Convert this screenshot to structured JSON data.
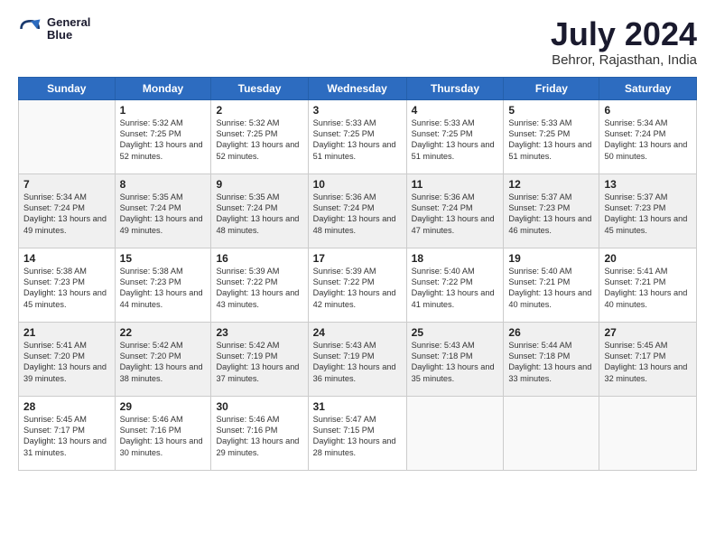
{
  "logo": {
    "line1": "General",
    "line2": "Blue"
  },
  "title": {
    "month_year": "July 2024",
    "location": "Behror, Rajasthan, India"
  },
  "weekdays": [
    "Sunday",
    "Monday",
    "Tuesday",
    "Wednesday",
    "Thursday",
    "Friday",
    "Saturday"
  ],
  "weeks": [
    [
      {
        "day": "",
        "sunrise": "",
        "sunset": "",
        "daylight": ""
      },
      {
        "day": "1",
        "sunrise": "Sunrise: 5:32 AM",
        "sunset": "Sunset: 7:25 PM",
        "daylight": "Daylight: 13 hours and 52 minutes."
      },
      {
        "day": "2",
        "sunrise": "Sunrise: 5:32 AM",
        "sunset": "Sunset: 7:25 PM",
        "daylight": "Daylight: 13 hours and 52 minutes."
      },
      {
        "day": "3",
        "sunrise": "Sunrise: 5:33 AM",
        "sunset": "Sunset: 7:25 PM",
        "daylight": "Daylight: 13 hours and 51 minutes."
      },
      {
        "day": "4",
        "sunrise": "Sunrise: 5:33 AM",
        "sunset": "Sunset: 7:25 PM",
        "daylight": "Daylight: 13 hours and 51 minutes."
      },
      {
        "day": "5",
        "sunrise": "Sunrise: 5:33 AM",
        "sunset": "Sunset: 7:25 PM",
        "daylight": "Daylight: 13 hours and 51 minutes."
      },
      {
        "day": "6",
        "sunrise": "Sunrise: 5:34 AM",
        "sunset": "Sunset: 7:24 PM",
        "daylight": "Daylight: 13 hours and 50 minutes."
      }
    ],
    [
      {
        "day": "7",
        "sunrise": "Sunrise: 5:34 AM",
        "sunset": "Sunset: 7:24 PM",
        "daylight": "Daylight: 13 hours and 49 minutes."
      },
      {
        "day": "8",
        "sunrise": "Sunrise: 5:35 AM",
        "sunset": "Sunset: 7:24 PM",
        "daylight": "Daylight: 13 hours and 49 minutes."
      },
      {
        "day": "9",
        "sunrise": "Sunrise: 5:35 AM",
        "sunset": "Sunset: 7:24 PM",
        "daylight": "Daylight: 13 hours and 48 minutes."
      },
      {
        "day": "10",
        "sunrise": "Sunrise: 5:36 AM",
        "sunset": "Sunset: 7:24 PM",
        "daylight": "Daylight: 13 hours and 48 minutes."
      },
      {
        "day": "11",
        "sunrise": "Sunrise: 5:36 AM",
        "sunset": "Sunset: 7:24 PM",
        "daylight": "Daylight: 13 hours and 47 minutes."
      },
      {
        "day": "12",
        "sunrise": "Sunrise: 5:37 AM",
        "sunset": "Sunset: 7:23 PM",
        "daylight": "Daylight: 13 hours and 46 minutes."
      },
      {
        "day": "13",
        "sunrise": "Sunrise: 5:37 AM",
        "sunset": "Sunset: 7:23 PM",
        "daylight": "Daylight: 13 hours and 45 minutes."
      }
    ],
    [
      {
        "day": "14",
        "sunrise": "Sunrise: 5:38 AM",
        "sunset": "Sunset: 7:23 PM",
        "daylight": "Daylight: 13 hours and 45 minutes."
      },
      {
        "day": "15",
        "sunrise": "Sunrise: 5:38 AM",
        "sunset": "Sunset: 7:23 PM",
        "daylight": "Daylight: 13 hours and 44 minutes."
      },
      {
        "day": "16",
        "sunrise": "Sunrise: 5:39 AM",
        "sunset": "Sunset: 7:22 PM",
        "daylight": "Daylight: 13 hours and 43 minutes."
      },
      {
        "day": "17",
        "sunrise": "Sunrise: 5:39 AM",
        "sunset": "Sunset: 7:22 PM",
        "daylight": "Daylight: 13 hours and 42 minutes."
      },
      {
        "day": "18",
        "sunrise": "Sunrise: 5:40 AM",
        "sunset": "Sunset: 7:22 PM",
        "daylight": "Daylight: 13 hours and 41 minutes."
      },
      {
        "day": "19",
        "sunrise": "Sunrise: 5:40 AM",
        "sunset": "Sunset: 7:21 PM",
        "daylight": "Daylight: 13 hours and 40 minutes."
      },
      {
        "day": "20",
        "sunrise": "Sunrise: 5:41 AM",
        "sunset": "Sunset: 7:21 PM",
        "daylight": "Daylight: 13 hours and 40 minutes."
      }
    ],
    [
      {
        "day": "21",
        "sunrise": "Sunrise: 5:41 AM",
        "sunset": "Sunset: 7:20 PM",
        "daylight": "Daylight: 13 hours and 39 minutes."
      },
      {
        "day": "22",
        "sunrise": "Sunrise: 5:42 AM",
        "sunset": "Sunset: 7:20 PM",
        "daylight": "Daylight: 13 hours and 38 minutes."
      },
      {
        "day": "23",
        "sunrise": "Sunrise: 5:42 AM",
        "sunset": "Sunset: 7:19 PM",
        "daylight": "Daylight: 13 hours and 37 minutes."
      },
      {
        "day": "24",
        "sunrise": "Sunrise: 5:43 AM",
        "sunset": "Sunset: 7:19 PM",
        "daylight": "Daylight: 13 hours and 36 minutes."
      },
      {
        "day": "25",
        "sunrise": "Sunrise: 5:43 AM",
        "sunset": "Sunset: 7:18 PM",
        "daylight": "Daylight: 13 hours and 35 minutes."
      },
      {
        "day": "26",
        "sunrise": "Sunrise: 5:44 AM",
        "sunset": "Sunset: 7:18 PM",
        "daylight": "Daylight: 13 hours and 33 minutes."
      },
      {
        "day": "27",
        "sunrise": "Sunrise: 5:45 AM",
        "sunset": "Sunset: 7:17 PM",
        "daylight": "Daylight: 13 hours and 32 minutes."
      }
    ],
    [
      {
        "day": "28",
        "sunrise": "Sunrise: 5:45 AM",
        "sunset": "Sunset: 7:17 PM",
        "daylight": "Daylight: 13 hours and 31 minutes."
      },
      {
        "day": "29",
        "sunrise": "Sunrise: 5:46 AM",
        "sunset": "Sunset: 7:16 PM",
        "daylight": "Daylight: 13 hours and 30 minutes."
      },
      {
        "day": "30",
        "sunrise": "Sunrise: 5:46 AM",
        "sunset": "Sunset: 7:16 PM",
        "daylight": "Daylight: 13 hours and 29 minutes."
      },
      {
        "day": "31",
        "sunrise": "Sunrise: 5:47 AM",
        "sunset": "Sunset: 7:15 PM",
        "daylight": "Daylight: 13 hours and 28 minutes."
      },
      {
        "day": "",
        "sunrise": "",
        "sunset": "",
        "daylight": ""
      },
      {
        "day": "",
        "sunrise": "",
        "sunset": "",
        "daylight": ""
      },
      {
        "day": "",
        "sunrise": "",
        "sunset": "",
        "daylight": ""
      }
    ]
  ]
}
